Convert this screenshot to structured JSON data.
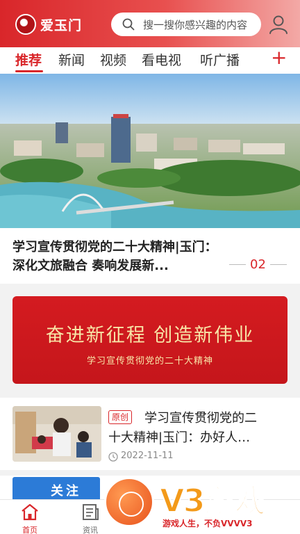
{
  "header": {
    "app_name": "爱玉门",
    "search_placeholder": "搜一搜你感兴趣的内容"
  },
  "tabs": [
    {
      "label": "推荐",
      "active": true
    },
    {
      "label": "新闻",
      "active": false
    },
    {
      "label": "视频",
      "active": false
    },
    {
      "label": "看电视",
      "active": false
    },
    {
      "label": "听广播",
      "active": false
    }
  ],
  "add_tab_symbol": "+",
  "hero": {
    "title_line1": "学习宣传贯彻党的二十大精神|玉门：",
    "title_line2": "深化文旅融合  奏响发展新...",
    "page_number": "02"
  },
  "banner": {
    "main": "奋进新征程  创造新伟业",
    "sub": "学习宣传贯彻党的二十大精神"
  },
  "article": {
    "badge": "原创",
    "title_line1": "学习宣传贯彻党的二",
    "title_line2": "十大精神|玉门：办好人…",
    "date": "2022-11-11"
  },
  "peek": {
    "button_text": "关注"
  },
  "bottom_nav": [
    {
      "label": "首页",
      "icon": "home-icon",
      "active": true
    },
    {
      "label": "资讯",
      "icon": "news-icon",
      "active": false
    }
  ],
  "watermark": {
    "logo": "V3游戏",
    "slogan": "游戏人生，不负VVVV3"
  },
  "colors": {
    "accent": "#d9262a",
    "banner_text": "#f8e6a8",
    "follow_button": "#2c7bd7"
  }
}
